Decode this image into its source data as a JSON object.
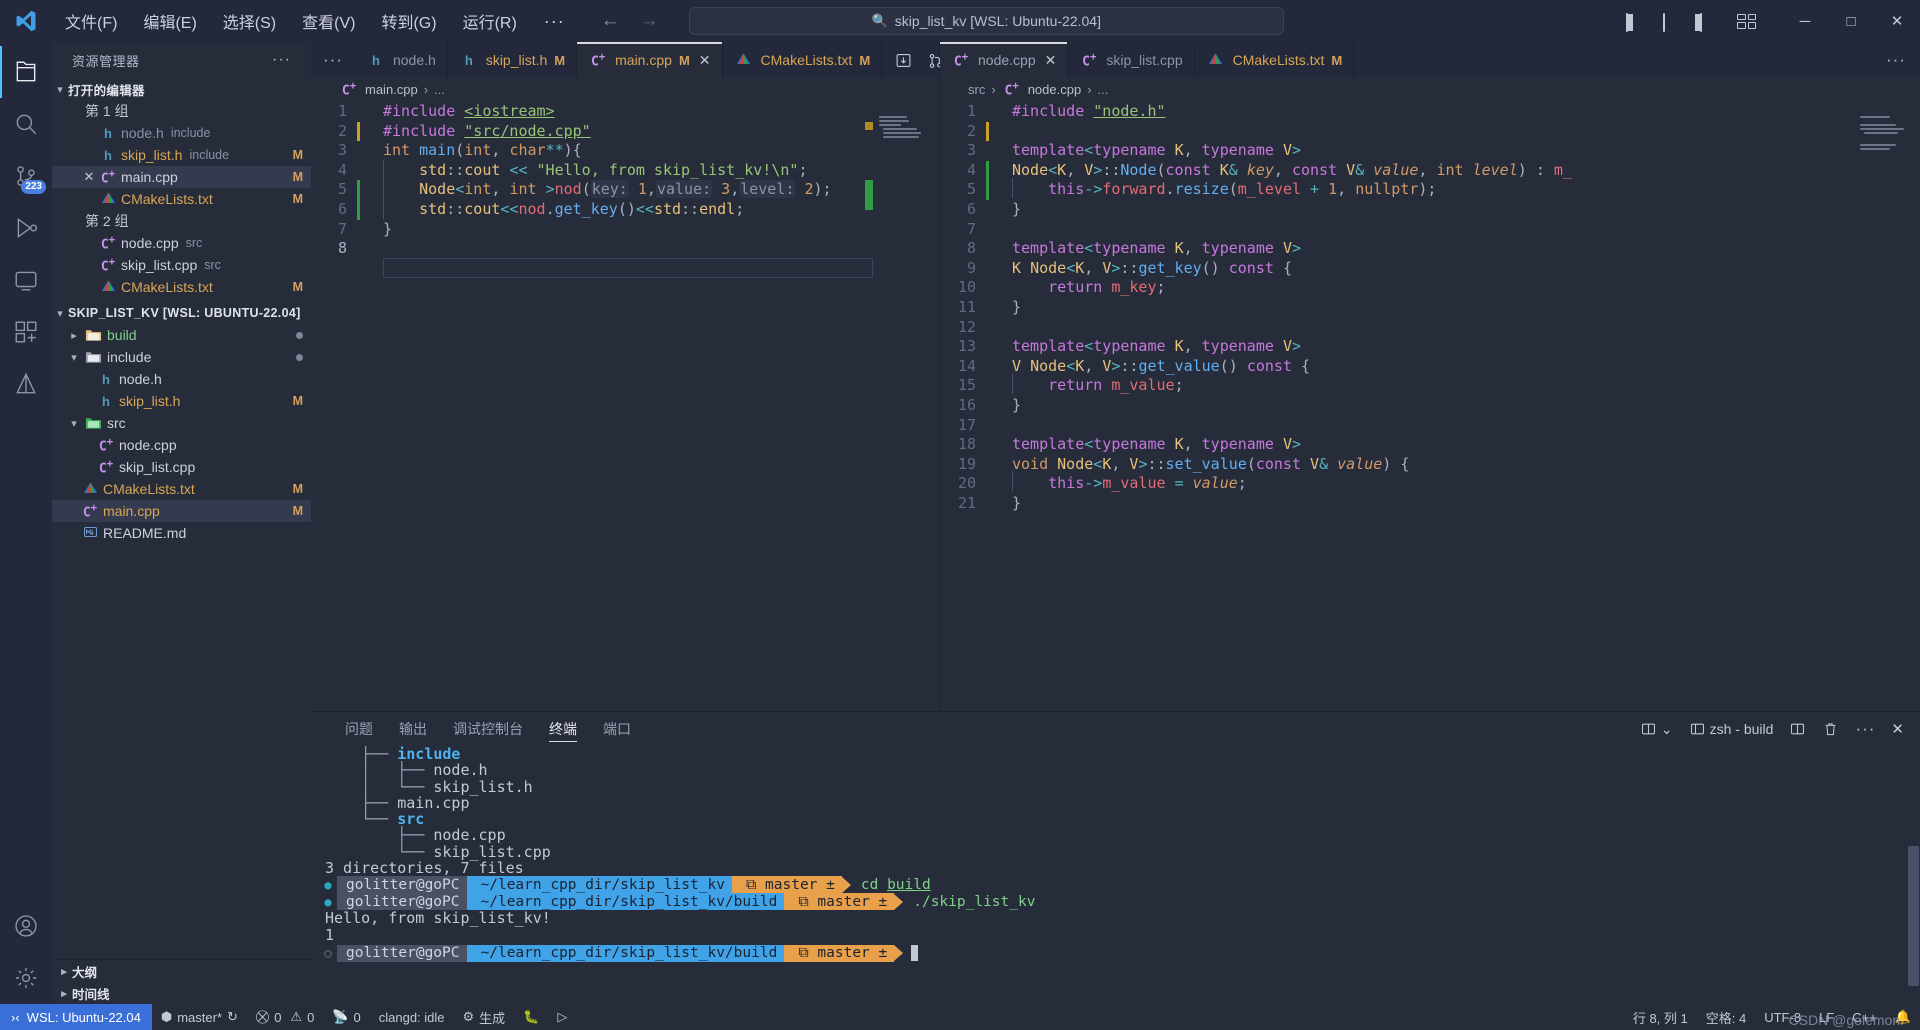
{
  "titlebar": {
    "menus": [
      "文件(F)",
      "编辑(E)",
      "选择(S)",
      "查看(V)",
      "转到(G)",
      "运行(R)"
    ],
    "more": "···",
    "back_icon": "←",
    "forward_icon": "→",
    "search_value": "skip_list_kv [WSL: Ubuntu-22.04]",
    "search_icon": "search-icon",
    "minimize": "─",
    "maximize": "□",
    "close": "✕"
  },
  "activitybar": {
    "items": [
      {
        "name": "explorer",
        "badge": ""
      },
      {
        "name": "search",
        "badge": ""
      },
      {
        "name": "source-control",
        "badge": "223"
      },
      {
        "name": "run-debug",
        "badge": ""
      },
      {
        "name": "remote-explorer",
        "badge": ""
      },
      {
        "name": "extensions",
        "badge": ""
      },
      {
        "name": "testing",
        "badge": ""
      }
    ],
    "accounts": "accounts",
    "settings": "settings"
  },
  "sidebar": {
    "title": "资源管理器",
    "more": "···",
    "open_editors": {
      "label": "打开的编辑器",
      "groups": [
        {
          "label": "第 1 组",
          "items": [
            {
              "icon": "h",
              "name": "node.h",
              "tag": "include",
              "mod": "",
              "selected": false,
              "dim": true
            },
            {
              "icon": "h",
              "name": "skip_list.h",
              "tag": "include",
              "mod": "M",
              "selected": false,
              "dim": false
            },
            {
              "icon": "cpp",
              "name": "main.cpp",
              "tag": "",
              "mod": "M",
              "selected": true,
              "dim": false
            },
            {
              "icon": "cmake",
              "name": "CMakeLists.txt",
              "tag": "",
              "mod": "M",
              "selected": false,
              "dim": false
            }
          ]
        },
        {
          "label": "第 2 组",
          "items": [
            {
              "icon": "cpp",
              "name": "node.cpp",
              "tag": "src",
              "mod": "",
              "selected": false,
              "dim": false
            },
            {
              "icon": "cpp",
              "name": "skip_list.cpp",
              "tag": "src",
              "mod": "",
              "selected": false,
              "dim": false
            },
            {
              "icon": "cmake",
              "name": "CMakeLists.txt",
              "tag": "",
              "mod": "M",
              "selected": false,
              "dim": false
            }
          ]
        }
      ]
    },
    "project": {
      "label": "SKIP_LIST_KV [WSL: UBUNTU-22.04]",
      "items": [
        {
          "kind": "folder",
          "name": "build",
          "indent": 1,
          "expanded": false,
          "dot": true,
          "color": "green"
        },
        {
          "kind": "folder",
          "name": "include",
          "indent": 1,
          "expanded": true,
          "dot": true,
          "color": "plain"
        },
        {
          "kind": "h",
          "name": "node.h",
          "indent": 2,
          "mod": ""
        },
        {
          "kind": "h",
          "name": "skip_list.h",
          "indent": 2,
          "mod": "M"
        },
        {
          "kind": "folder",
          "name": "src",
          "indent": 1,
          "expanded": true,
          "dot": false,
          "color": "plain"
        },
        {
          "kind": "cpp",
          "name": "node.cpp",
          "indent": 2,
          "mod": ""
        },
        {
          "kind": "cpp",
          "name": "skip_list.cpp",
          "indent": 2,
          "mod": ""
        },
        {
          "kind": "cmake",
          "name": "CMakeLists.txt",
          "indent": 1,
          "mod": "M"
        },
        {
          "kind": "cpp",
          "name": "main.cpp",
          "indent": 1,
          "mod": "M",
          "selected": true
        },
        {
          "kind": "md",
          "name": "README.md",
          "indent": 1,
          "mod": ""
        }
      ]
    },
    "sections": [
      {
        "label": "大纲"
      },
      {
        "label": "时间线"
      }
    ]
  },
  "left_pane": {
    "tabs": [
      {
        "icon": "dots",
        "label": "···",
        "kind": "overflow"
      },
      {
        "icon": "h",
        "label": "node.h",
        "mod": "",
        "active": false,
        "dim": true,
        "close": false
      },
      {
        "icon": "h",
        "label": "skip_list.h",
        "mod": "M",
        "active": false,
        "dim": false,
        "close": false
      },
      {
        "icon": "cpp",
        "label": "main.cpp",
        "mod": "M",
        "active": true,
        "dim": false,
        "close": true
      },
      {
        "icon": "cmake",
        "label": "CMakeLists.txt",
        "mod": "M",
        "active": false,
        "dim": false,
        "close": false
      }
    ],
    "actions": [
      "run-icon",
      "split-source-control-icon",
      "split-editor-icon",
      "more-icon"
    ],
    "breadcrumb": {
      "file_icon": "cpp",
      "file": "main.cpp",
      "sep": "›",
      "rest": "..."
    },
    "lines": [
      {
        "n": 1,
        "marker": "",
        "html": "<span class=\"pp\">#include</span> <span class=\"incl\">&lt;iostream&gt;</span>"
      },
      {
        "n": 2,
        "marker": "mod",
        "html": "<span class=\"pp\">#include</span> <span class=\"incl\">\"src/node.cpp\"</span>"
      },
      {
        "n": 3,
        "marker": "",
        "html": "<span class=\"kw2\">int</span> <span class=\"fn\">main</span><span class=\"pun\">(</span><span class=\"kw2\">int</span><span class=\"pun\">,</span> <span class=\"kw2\">char</span><span class=\"op\">**</span><span class=\"pun\">){</span>"
      },
      {
        "n": 4,
        "marker": "",
        "html": "    <span class=\"ns\">std</span><span class=\"pun\">::</span><span class=\"typ\">cout</span> <span class=\"op\">&lt;&lt;</span> <span class=\"str\">\"Hello, from skip_list_kv!\\n\"</span><span class=\"pun\">;</span>"
      },
      {
        "n": 5,
        "marker": "add",
        "html": "    <span class=\"typ\">Node</span><span class=\"op\">&lt;</span><span class=\"kw2\">int</span><span class=\"pun\">,</span> <span class=\"kw2\">int</span> <span class=\"op\">&gt;</span><span class=\"var\">nod</span><span class=\"pun\">(</span><span class=\"hint\">key:</span> <span class=\"num\">1</span><span class=\"pun\">,</span><span class=\"hint\">value:</span> <span class=\"num\">3</span><span class=\"pun\">,</span><span class=\"hint\">level:</span> <span class=\"num\">2</span><span class=\"pun\">);</span>"
      },
      {
        "n": 6,
        "marker": "add",
        "html": "    <span class=\"ns\">std</span><span class=\"pun\">::</span><span class=\"typ\">cout</span><span class=\"op\">&lt;&lt;</span><span class=\"var\">nod</span><span class=\"pun\">.</span><span class=\"mem\">get_key</span><span class=\"pun\">()</span><span class=\"op\">&lt;&lt;</span><span class=\"ns\">std</span><span class=\"pun\">::</span><span class=\"typ\">endl</span><span class=\"pun\">;</span>"
      },
      {
        "n": 7,
        "marker": "",
        "html": "<span class=\"pun\">}</span>"
      },
      {
        "n": 8,
        "marker": "",
        "html": ""
      }
    ]
  },
  "right_pane": {
    "tabs": [
      {
        "icon": "cpp",
        "label": "node.cpp",
        "mod": "",
        "active": true,
        "dim": true,
        "close": true
      },
      {
        "icon": "cpp",
        "label": "skip_list.cpp",
        "mod": "",
        "active": false,
        "dim": true,
        "close": false
      },
      {
        "icon": "cmake",
        "label": "CMakeLists.txt",
        "mod": "M",
        "active": false,
        "dim": false,
        "close": false
      }
    ],
    "more": "···",
    "breadcrumb": {
      "folder": "src",
      "sep": "›",
      "file": "node.cpp",
      "rest": "..."
    },
    "lines": [
      {
        "n": 1,
        "marker": "",
        "html": "<span class=\"pp\">#include</span> <span class=\"incl\">\"node.h\"</span>"
      },
      {
        "n": 2,
        "marker": "mod",
        "html": ""
      },
      {
        "n": 3,
        "marker": "",
        "html": "<span class=\"kw\">template</span><span class=\"op\">&lt;</span><span class=\"kw\">typename</span> <span class=\"typ\">K</span><span class=\"pun\">,</span> <span class=\"kw\">typename</span> <span class=\"typ\">V</span><span class=\"op\">&gt;</span>"
      },
      {
        "n": 4,
        "marker": "add",
        "html": "<span class=\"typ\">Node</span><span class=\"op\">&lt;</span><span class=\"typ\">K</span><span class=\"pun\">,</span> <span class=\"typ\">V</span><span class=\"op\">&gt;</span><span class=\"pun\">::</span><span class=\"fn\">Node</span><span class=\"pun\">(</span><span class=\"kw\">const</span> <span class=\"typ\">K</span><span class=\"op\">&amp;</span> <span class=\"param\">key</span><span class=\"pun\">,</span> <span class=\"kw\">const</span> <span class=\"typ\">V</span><span class=\"op\">&amp;</span> <span class=\"param\">value</span><span class=\"pun\">,</span> <span class=\"kw2\">int</span> <span class=\"param\">level</span><span class=\"pun\">)</span> <span class=\"pun\">:</span> <span class=\"var\">m_</span>"
      },
      {
        "n": 5,
        "marker": "add",
        "html": "    <span class=\"kw\">this</span><span class=\"op\">-&gt;</span><span class=\"var\">forward</span><span class=\"pun\">.</span><span class=\"mem\">resize</span><span class=\"pun\">(</span><span class=\"var\">m_level</span> <span class=\"op\">+</span> <span class=\"num\">1</span><span class=\"pun\">,</span> <span class=\"kw2\">nullptr</span><span class=\"pun\">);</span>"
      },
      {
        "n": 6,
        "marker": "",
        "html": "<span class=\"pun\">}</span>"
      },
      {
        "n": 7,
        "marker": "",
        "html": ""
      },
      {
        "n": 8,
        "marker": "",
        "html": "<span class=\"kw\">template</span><span class=\"op\">&lt;</span><span class=\"kw\">typename</span> <span class=\"typ\">K</span><span class=\"pun\">,</span> <span class=\"kw\">typename</span> <span class=\"typ\">V</span><span class=\"op\">&gt;</span>"
      },
      {
        "n": 9,
        "marker": "",
        "html": "<span class=\"typ\">K</span> <span class=\"typ\">Node</span><span class=\"op\">&lt;</span><span class=\"typ\">K</span><span class=\"pun\">,</span> <span class=\"typ\">V</span><span class=\"op\">&gt;</span><span class=\"pun\">::</span><span class=\"fn\">get_key</span><span class=\"pun\">()</span> <span class=\"kw\">const</span> <span class=\"pun\">{</span>"
      },
      {
        "n": 10,
        "marker": "",
        "html": "    <span class=\"kw\">return</span> <span class=\"var\">m_key</span><span class=\"pun\">;</span>"
      },
      {
        "n": 11,
        "marker": "",
        "html": "<span class=\"pun\">}</span>"
      },
      {
        "n": 12,
        "marker": "",
        "html": ""
      },
      {
        "n": 13,
        "marker": "",
        "html": "<span class=\"kw\">template</span><span class=\"op\">&lt;</span><span class=\"kw\">typename</span> <span class=\"typ\">K</span><span class=\"pun\">,</span> <span class=\"kw\">typename</span> <span class=\"typ\">V</span><span class=\"op\">&gt;</span>"
      },
      {
        "n": 14,
        "marker": "",
        "html": "<span class=\"typ\">V</span> <span class=\"typ\">Node</span><span class=\"op\">&lt;</span><span class=\"typ\">K</span><span class=\"pun\">,</span> <span class=\"typ\">V</span><span class=\"op\">&gt;</span><span class=\"pun\">::</span><span class=\"fn\">get_value</span><span class=\"pun\">()</span> <span class=\"kw\">const</span> <span class=\"pun\">{</span>"
      },
      {
        "n": 15,
        "marker": "",
        "html": "    <span class=\"kw\">return</span> <span class=\"var\">m_value</span><span class=\"pun\">;</span>"
      },
      {
        "n": 16,
        "marker": "",
        "html": "<span class=\"pun\">}</span>"
      },
      {
        "n": 17,
        "marker": "",
        "html": ""
      },
      {
        "n": 18,
        "marker": "",
        "html": "<span class=\"kw\">template</span><span class=\"op\">&lt;</span><span class=\"kw\">typename</span> <span class=\"typ\">K</span><span class=\"pun\">,</span> <span class=\"kw\">typename</span> <span class=\"typ\">V</span><span class=\"op\">&gt;</span>"
      },
      {
        "n": 19,
        "marker": "",
        "html": "<span class=\"kw2\">void</span> <span class=\"typ\">Node</span><span class=\"op\">&lt;</span><span class=\"typ\">K</span><span class=\"pun\">,</span> <span class=\"typ\">V</span><span class=\"op\">&gt;</span><span class=\"pun\">::</span><span class=\"fn\">set_value</span><span class=\"pun\">(</span><span class=\"kw\">const</span> <span class=\"typ\">V</span><span class=\"op\">&amp;</span> <span class=\"param\">value</span><span class=\"pun\">)</span> <span class=\"pun\">{</span>"
      },
      {
        "n": 20,
        "marker": "",
        "html": "    <span class=\"kw\">this</span><span class=\"op\">-&gt;</span><span class=\"var\">m_value</span> <span class=\"op\">=</span> <span class=\"param\">value</span><span class=\"pun\">;</span>"
      },
      {
        "n": 21,
        "marker": "",
        "html": "<span class=\"pun\">}</span>"
      }
    ]
  },
  "panel": {
    "tabs": [
      {
        "label": "问题",
        "active": false
      },
      {
        "label": "输出",
        "active": false
      },
      {
        "label": "调试控制台",
        "active": false
      },
      {
        "label": "终端",
        "active": true
      },
      {
        "label": "端口",
        "active": false
      }
    ],
    "actions": {
      "split_select": "split-terminal-dropdown",
      "chevron": "⌄",
      "shell_label": "zsh - build",
      "split_icon": "split-terminal-icon",
      "trash_icon": "trash-icon",
      "more_icon": "···",
      "close_icon": "✕"
    },
    "terminal_tree": [
      {
        "prefix": "    ├── ",
        "name": "include",
        "bold": true
      },
      {
        "prefix": "    │   ├── ",
        "name": "node.h",
        "bold": false
      },
      {
        "prefix": "    │   └── ",
        "name": "skip_list.h",
        "bold": false
      },
      {
        "prefix": "    ├── ",
        "name": "main.cpp",
        "bold": false
      },
      {
        "prefix": "    └── ",
        "name": "src",
        "bold": true
      },
      {
        "prefix": "        ├── ",
        "name": "node.cpp",
        "bold": false
      },
      {
        "prefix": "        └── ",
        "name": "skip_list.cpp",
        "bold": false
      }
    ],
    "summary": "3 directories, 7 files",
    "prompts": [
      {
        "user": "golitter@goPC",
        "path": "~/learn_cpp_dir/skip_list_kv",
        "git": "⧉ master ±",
        "cmd": "cd build",
        "cmd_underline": "build",
        "cmd_plain": "cd ",
        "dot": "filled"
      },
      {
        "user": "golitter@goPC",
        "path": "~/learn_cpp_dir/skip_list_kv/build",
        "git": "⧉ master ±",
        "cmd": "./skip_list_kv",
        "cmd_underline": "",
        "cmd_plain": "./skip_list_kv",
        "dot": "filled"
      }
    ],
    "output": [
      "Hello, from skip_list_kv!",
      "1"
    ],
    "last_prompt": {
      "user": "golitter@goPC",
      "path": "~/learn_cpp_dir/skip_list_kv/build",
      "git": "⧉ master ±",
      "dot": "hollow"
    }
  },
  "statusbar": {
    "remote": "WSL: Ubuntu-22.04",
    "branch": "master*",
    "sync_icon": "↻",
    "errors": "0",
    "warnings": "0",
    "radio": "0",
    "clangd": "clangd: idle",
    "build": "生成",
    "debug_icon": "debug-icon",
    "run_icon": "▷",
    "position": "行 8, 列 1",
    "spaces": "空格: 4",
    "encoding": "UTF-8",
    "eol": "LF",
    "language": "C++",
    "bell_icon": "bell-icon"
  },
  "watermark": "CSDN @golemon."
}
